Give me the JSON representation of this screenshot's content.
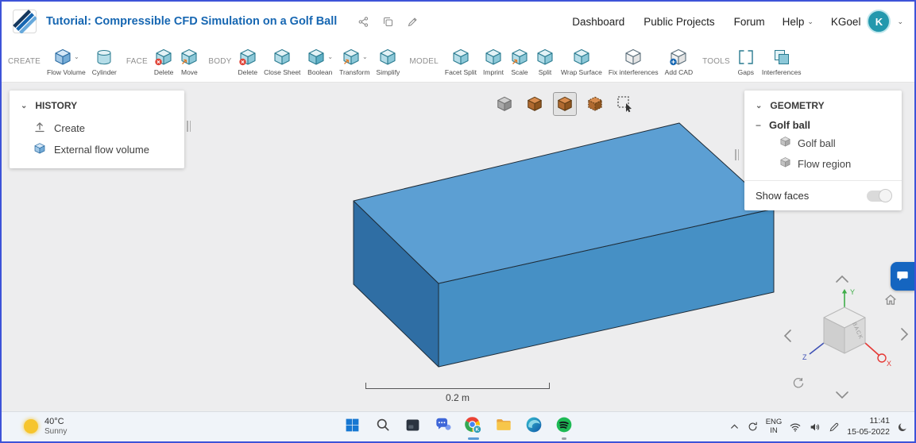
{
  "header": {
    "title": "Tutorial: Compressible CFD Simulation on a Golf Ball",
    "doc_actions": [
      {
        "name": "share-icon"
      },
      {
        "name": "copy-icon"
      },
      {
        "name": "edit-icon"
      }
    ],
    "nav_items": [
      "Dashboard",
      "Public Projects",
      "Forum"
    ],
    "help_label": "Help",
    "user_name": "KGoel",
    "avatar_letter": "K"
  },
  "toolbar": {
    "groups": [
      {
        "label": "CREATE",
        "items": [
          {
            "label": "Flow Volume",
            "icon": "flow-volume-icon",
            "chevron": true
          },
          {
            "label": "Cylinder",
            "icon": "cylinder-icon"
          }
        ]
      },
      {
        "label": "FACE",
        "items": [
          {
            "label": "Delete",
            "icon": "delete-face-icon"
          },
          {
            "label": "Move",
            "icon": "move-face-icon"
          }
        ]
      },
      {
        "label": "BODY",
        "items": [
          {
            "label": "Delete",
            "icon": "delete-body-icon"
          },
          {
            "label": "Close Sheet",
            "icon": "close-sheet-icon"
          },
          {
            "label": "Boolean",
            "icon": "boolean-icon",
            "chevron": true
          },
          {
            "label": "Transform",
            "icon": "transform-icon",
            "chevron": true
          },
          {
            "label": "Simplify",
            "icon": "simplify-icon"
          }
        ]
      },
      {
        "label": "MODEL",
        "items": [
          {
            "label": "Facet Split",
            "icon": "facet-split-icon"
          },
          {
            "label": "Imprint",
            "icon": "imprint-icon"
          },
          {
            "label": "Scale",
            "icon": "scale-icon"
          },
          {
            "label": "Split",
            "icon": "split-icon"
          },
          {
            "label": "Wrap Surface",
            "icon": "wrap-surface-icon"
          },
          {
            "label": "Fix interferences",
            "icon": "fix-interferences-icon"
          },
          {
            "label": "Add CAD",
            "icon": "add-cad-icon"
          }
        ]
      },
      {
        "label": "TOOLS",
        "items": [
          {
            "label": "Gaps",
            "icon": "gaps-icon"
          },
          {
            "label": "Interferences",
            "icon": "interferences-icon"
          }
        ]
      }
    ]
  },
  "history_panel": {
    "title": "HISTORY",
    "items": [
      {
        "label": "Create",
        "icon": "create-icon"
      },
      {
        "label": "External flow volume",
        "icon": "flow-volume-cube-icon"
      }
    ]
  },
  "geometry_panel": {
    "title": "GEOMETRY",
    "root_label": "Golf ball",
    "children": [
      {
        "label": "Golf ball",
        "icon": "body-icon"
      },
      {
        "label": "Flow region",
        "icon": "body-icon"
      }
    ],
    "show_faces_label": "Show faces",
    "show_faces_on": true
  },
  "viewbar": {
    "buttons": [
      {
        "name": "view-solid-icon",
        "style": "gray"
      },
      {
        "name": "view-shaded-icon",
        "style": "orange"
      },
      {
        "name": "view-shaded-edges-icon",
        "style": "orange",
        "selected": true
      },
      {
        "name": "view-hidden-edges-icon",
        "style": "orange-dashed"
      },
      {
        "name": "box-select-icon",
        "style": "select"
      }
    ]
  },
  "viewport": {
    "scale_label": "0.2 m",
    "axis_x": "X",
    "axis_y": "Y",
    "axis_z": "Z",
    "cube_face_label": "BACK",
    "box_colors": {
      "top": "#5C9FD3",
      "front": "#4690C5",
      "left": "#2F6EA4"
    }
  },
  "taskbar": {
    "weather_temp": "40°C",
    "weather_desc": "Sunny",
    "apps": [
      {
        "name": "start-button",
        "icon": "windows-icon"
      },
      {
        "name": "search-button",
        "icon": "search-icon"
      },
      {
        "name": "task-view-button",
        "icon": "dark-app-icon"
      },
      {
        "name": "chat-button",
        "icon": "teams-chat-icon"
      },
      {
        "name": "browser-profile-button",
        "icon": "chrome-icon",
        "badge": "K",
        "active": true
      },
      {
        "name": "file-explorer-button",
        "icon": "folder-icon"
      },
      {
        "name": "edge-button",
        "icon": "edge-icon"
      },
      {
        "name": "spotify-button",
        "icon": "spotify-icon",
        "running": true
      }
    ],
    "tray": {
      "language": "ENG",
      "region": "IN",
      "time": "11:41",
      "date": "15-05-2022"
    }
  }
}
